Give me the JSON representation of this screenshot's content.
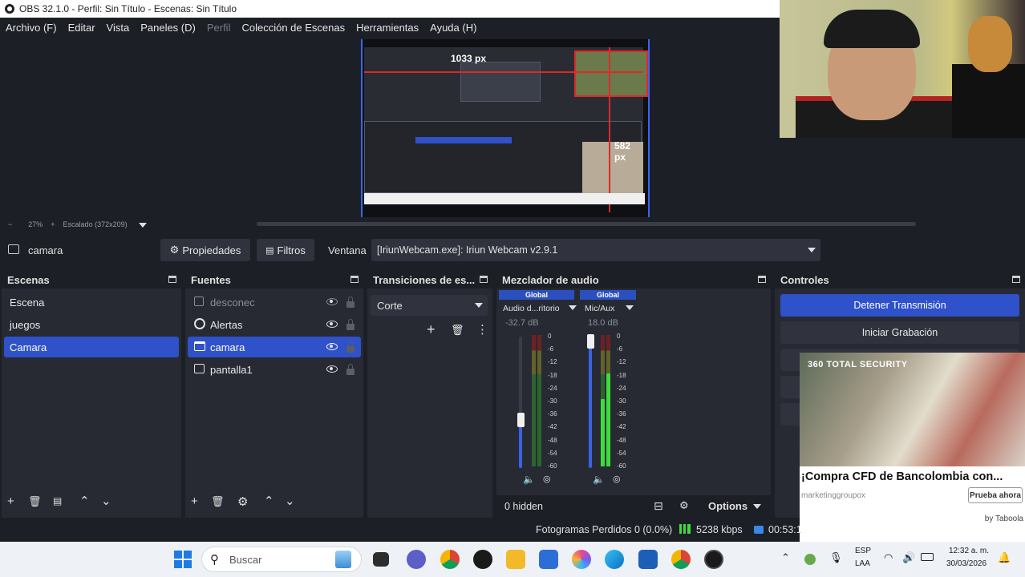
{
  "window": {
    "title": "OBS 32.1.0 - Perfil: Sin Título - Escenas: Sin Título"
  },
  "menu": [
    {
      "label": "Archivo (F)",
      "disabled": false
    },
    {
      "label": "Editar",
      "disabled": false
    },
    {
      "label": "Vista",
      "disabled": false
    },
    {
      "label": "Paneles (D)",
      "disabled": false
    },
    {
      "label": "Perfil",
      "disabled": true
    },
    {
      "label": "Colección de Escenas",
      "disabled": false
    },
    {
      "label": "Herramientas",
      "disabled": false
    },
    {
      "label": "Ayuda (H)",
      "disabled": false
    }
  ],
  "preview": {
    "label_width": "1033 px",
    "label_height": "582 px",
    "zoom": "27%",
    "scale_text": "Escalado (372x209)",
    "zoom_out": "−",
    "zoom_in": "+"
  },
  "source_toolbar": {
    "selected_source": "camara",
    "properties": "Propiedades",
    "filters": "Filtros",
    "window_label": "Ventana",
    "window_value": "[IriunWebcam.exe]: Iriun Webcam v2.9.1"
  },
  "scenes": {
    "title": "Escenas",
    "items": [
      {
        "label": "Escena",
        "selected": false
      },
      {
        "label": "juegos",
        "selected": false
      },
      {
        "label": "Camara",
        "selected": true
      }
    ]
  },
  "sources": {
    "title": "Fuentes",
    "items": [
      {
        "label": "desconec",
        "icon": "image-icon",
        "visible": false,
        "selected": false
      },
      {
        "label": "Alertas",
        "icon": "browser-icon",
        "visible": true,
        "selected": false
      },
      {
        "label": "camara",
        "icon": "window-capture-icon",
        "visible": true,
        "selected": true
      },
      {
        "label": "pantalla1",
        "icon": "display-capture-icon",
        "visible": true,
        "selected": false
      }
    ]
  },
  "transitions": {
    "title": "Transiciones de es...",
    "selected": "Corte"
  },
  "mixer": {
    "title": "Mezclador de audio",
    "channels": [
      {
        "tag": "Global",
        "name": "Audio d...ritorio",
        "db": "-32.7 dB"
      },
      {
        "tag": "Global",
        "name": "Mic/Aux",
        "db": "18.0 dB"
      }
    ],
    "ticks": [
      "0",
      "-6",
      "-12",
      "-18",
      "-24",
      "-30",
      "-36",
      "-42",
      "-48",
      "-54",
      "-60"
    ],
    "hidden": "0 hidden",
    "options": "Options"
  },
  "controls": {
    "title": "Controles",
    "stop_stream": "Detener Transmisión",
    "start_recording": "Iniciar Grabación"
  },
  "ad": {
    "brand": "360 TOTAL SECURITY",
    "title": "¡Compra CFD de Bancolombia con...",
    "source": "marketinggroupox",
    "cta": "Prueba ahora",
    "by": "by Taboola"
  },
  "status": {
    "dropped_frames": "Fotogramas Perdidos 0 (0.0%)",
    "bitrate": "5238 kbps",
    "time": "00:53:1"
  },
  "taskbar": {
    "search": "Buscar",
    "lang_top": "ESP",
    "lang_bottom": "LAA",
    "clock_time": "12:32 a. m.",
    "clock_date": "30/03/2026"
  }
}
